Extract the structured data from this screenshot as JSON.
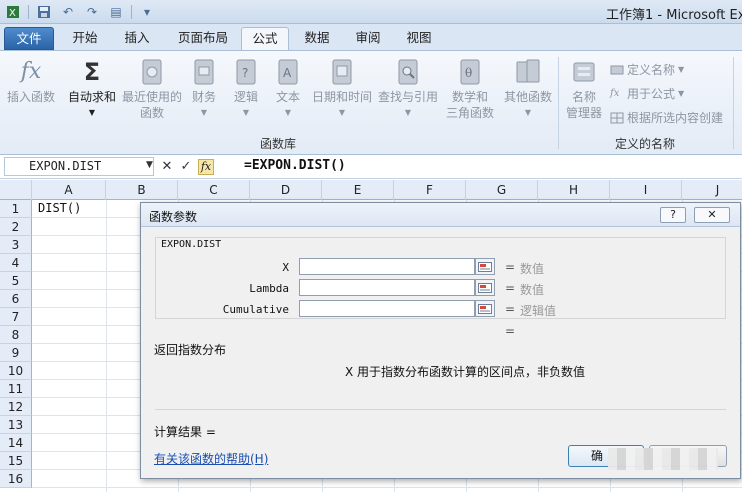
{
  "window": {
    "title": "工作簿1 - Microsoft Ex"
  },
  "tabs": [
    {
      "label": "文件"
    },
    {
      "label": "开始"
    },
    {
      "label": "插入"
    },
    {
      "label": "页面布局"
    },
    {
      "label": "公式"
    },
    {
      "label": "数据"
    },
    {
      "label": "审阅"
    },
    {
      "label": "视图"
    }
  ],
  "ribbon": {
    "insert_function": {
      "icon": "fx",
      "label": "插入函数"
    },
    "autosum": {
      "icon": "Σ",
      "label": "自动求和"
    },
    "recent": {
      "line1": "最近使用的",
      "line2": "函数"
    },
    "financial": {
      "label": "财务"
    },
    "logical": {
      "label": "逻辑"
    },
    "text": {
      "label": "文本"
    },
    "datetime": {
      "label": "日期和时间"
    },
    "lookup": {
      "label": "查找与引用"
    },
    "math": {
      "line1": "数学和",
      "line2": "三角函数"
    },
    "more": {
      "label": "其他函数"
    },
    "function_library_label": "函数库",
    "name_manager": {
      "line1": "名称",
      "line2": "管理器"
    },
    "define_name": "定义名称",
    "use_in_formula": "用于公式",
    "create_from_selection": "根据所选内容创建",
    "defined_names_label": "定义的名称"
  },
  "formula_bar": {
    "name_box": "EXPON.DIST",
    "formula": "=EXPON.DIST()"
  },
  "grid": {
    "columns": [
      "A",
      "B",
      "C",
      "D",
      "E",
      "F",
      "G",
      "H",
      "I",
      "J"
    ],
    "rows": [
      "1",
      "2",
      "3",
      "4",
      "5",
      "6",
      "7",
      "8",
      "9",
      "10",
      "11",
      "12",
      "13",
      "14",
      "15",
      "16"
    ],
    "cell_a1": "DIST()"
  },
  "dialog": {
    "title": "函数参数",
    "function_name": "EXPON.DIST",
    "args": [
      {
        "label": "X",
        "hint": "数值"
      },
      {
        "label": "Lambda",
        "hint": "数值"
      },
      {
        "label": "Cumulative",
        "hint": "逻辑值"
      }
    ],
    "eq": "=",
    "description": "返回指数分布",
    "arg_description": "X  用于指数分布函数计算的区间点，非负数值",
    "result_label": "计算结果 =",
    "help_link": "有关该函数的帮助(H)",
    "ok_label": "确"
  }
}
